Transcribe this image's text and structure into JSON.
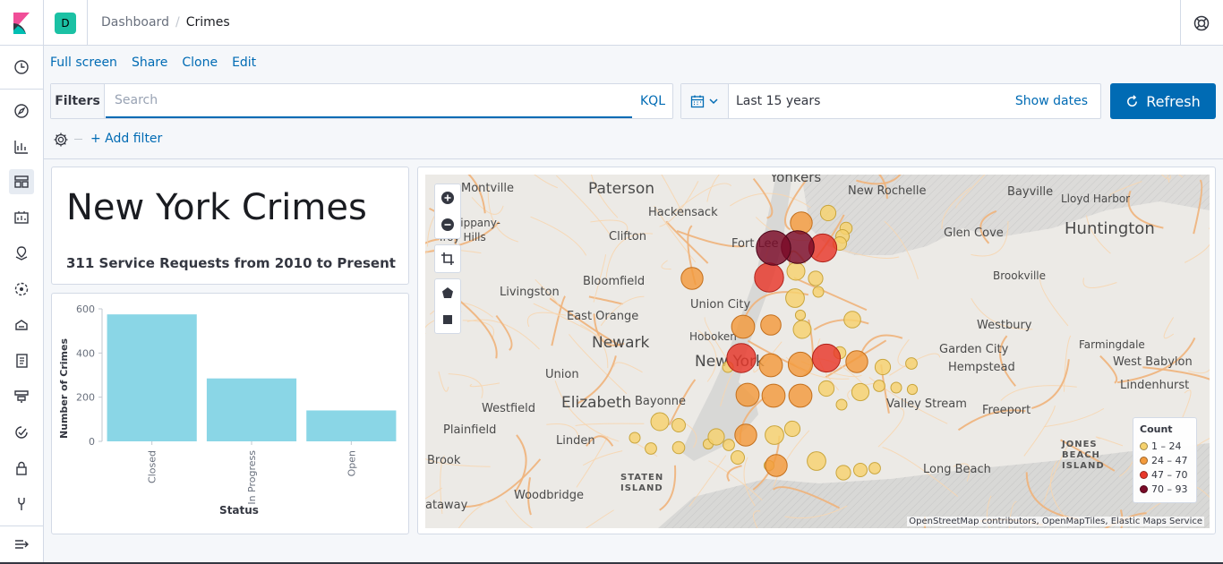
{
  "header": {
    "space_initial": "D",
    "breadcrumbs": [
      "Dashboard",
      "Crimes"
    ]
  },
  "actions": [
    "Full screen",
    "Share",
    "Clone",
    "Edit"
  ],
  "query": {
    "filters_label": "Filters",
    "search_placeholder": "Search",
    "kql_label": "KQL",
    "time_range": "Last 15 years",
    "show_dates": "Show dates",
    "refresh_label": "Refresh",
    "add_filter": "+ Add filter"
  },
  "title_panel": {
    "title": "New York Crimes",
    "subtitle": "311 Service Requests from 2010 to Present"
  },
  "chart_data": {
    "type": "bar",
    "categories": [
      "Closed",
      "In Progress",
      "Open"
    ],
    "values": [
      575,
      285,
      140
    ],
    "xlabel": "Status",
    "ylabel": "Number of Crimes",
    "ylim": [
      0,
      600
    ],
    "yticks": [
      0,
      200,
      400,
      600
    ],
    "bar_color": "#8ad6e6",
    "grid": false
  },
  "map": {
    "labels": [
      {
        "text": "Paterson",
        "size": 17
      },
      {
        "text": "Montville",
        "size": 13
      },
      {
        "text": "Yonkers",
        "size": 15
      },
      {
        "text": "New Rochelle",
        "size": 13
      },
      {
        "text": "Bayville",
        "size": 13
      },
      {
        "text": "Lloyd Harbor",
        "size": 12
      },
      {
        "text": "Hackensack",
        "size": 13
      },
      {
        "text": "Parsippany-Troy Hills",
        "size": 12
      },
      {
        "text": "Clifton",
        "size": 13
      },
      {
        "text": "Fort Lee",
        "size": 13
      },
      {
        "text": "Glen Cove",
        "size": 13
      },
      {
        "text": "Huntington",
        "size": 18
      },
      {
        "text": "Livingston",
        "size": 13
      },
      {
        "text": "Bloomfield",
        "size": 13
      },
      {
        "text": "Brookville",
        "size": 12
      },
      {
        "text": "Union City",
        "size": 13
      },
      {
        "text": "East Orange",
        "size": 13
      },
      {
        "text": "Newark",
        "size": 17
      },
      {
        "text": "Hoboken",
        "size": 12
      },
      {
        "text": "Westbury",
        "size": 13
      },
      {
        "text": "Farmingdale",
        "size": 12
      },
      {
        "text": "Garden City",
        "size": 13
      },
      {
        "text": "Hempstead",
        "size": 13
      },
      {
        "text": "West Babylon",
        "size": 13
      },
      {
        "text": "New York",
        "size": 17
      },
      {
        "text": "Union",
        "size": 13
      },
      {
        "text": "Lindenhurst",
        "size": 13
      },
      {
        "text": "Elizabeth",
        "size": 17
      },
      {
        "text": "Bayonne",
        "size": 13
      },
      {
        "text": "Westfield",
        "size": 13
      },
      {
        "text": "Valley Stream",
        "size": 13
      },
      {
        "text": "Freeport",
        "size": 13
      },
      {
        "text": "Plainfield",
        "size": 13
      },
      {
        "text": "Linden",
        "size": 13
      },
      {
        "text": "Brook",
        "size": 13
      },
      {
        "text": "JONES BEACH ISLAND",
        "size": 10
      },
      {
        "text": "Long Beach",
        "size": 13
      },
      {
        "text": "STATEN ISLAND",
        "size": 10
      },
      {
        "text": "Woodbridge",
        "size": 13
      },
      {
        "text": "ataway",
        "size": 13
      }
    ],
    "legend": {
      "title": "Count",
      "items": [
        {
          "label": "1 – 24",
          "color": "#f6d26e"
        },
        {
          "label": "24 – 47",
          "color": "#f39a3c"
        },
        {
          "label": "47 – 70",
          "color": "#e8372a"
        },
        {
          "label": "70 – 93",
          "color": "#7a0a27"
        }
      ]
    },
    "points": [
      {
        "count": 90
      },
      {
        "count": 80
      },
      {
        "count": 55
      },
      {
        "count": 30
      },
      {
        "count": 12
      },
      {
        "count": 8
      },
      {
        "count": 60
      },
      {
        "count": 18
      },
      {
        "count": 10
      },
      {
        "count": 8
      },
      {
        "count": 6
      },
      {
        "count": 30
      },
      {
        "count": 20
      },
      {
        "count": 35
      },
      {
        "count": 25
      },
      {
        "count": 18
      },
      {
        "count": 15
      },
      {
        "count": 60
      },
      {
        "count": 35
      },
      {
        "count": 40
      },
      {
        "count": 55
      },
      {
        "count": 30
      },
      {
        "count": 12
      },
      {
        "count": 5
      },
      {
        "count": 35
      },
      {
        "count": 35
      },
      {
        "count": 35
      },
      {
        "count": 12
      },
      {
        "count": 16
      },
      {
        "count": 4
      },
      {
        "count": 30
      },
      {
        "count": 20
      },
      {
        "count": 12
      },
      {
        "count": 14
      },
      {
        "count": 18
      },
      {
        "count": 6
      },
      {
        "count": 8
      },
      {
        "count": 30
      },
      {
        "count": 20
      },
      {
        "count": 10
      },
      {
        "count": 8
      },
      {
        "count": 5
      },
      {
        "count": 5
      },
      {
        "count": 4
      },
      {
        "count": 3
      },
      {
        "count": 5
      },
      {
        "count": 4
      },
      {
        "count": 3
      },
      {
        "count": 8
      },
      {
        "count": 5
      },
      {
        "count": 6
      },
      {
        "count": 4
      },
      {
        "count": 3
      },
      {
        "count": 4
      },
      {
        "count": 3
      }
    ],
    "attribution": "OpenStreetMap contributors, OpenMapTiles, Elastic Maps Service"
  }
}
